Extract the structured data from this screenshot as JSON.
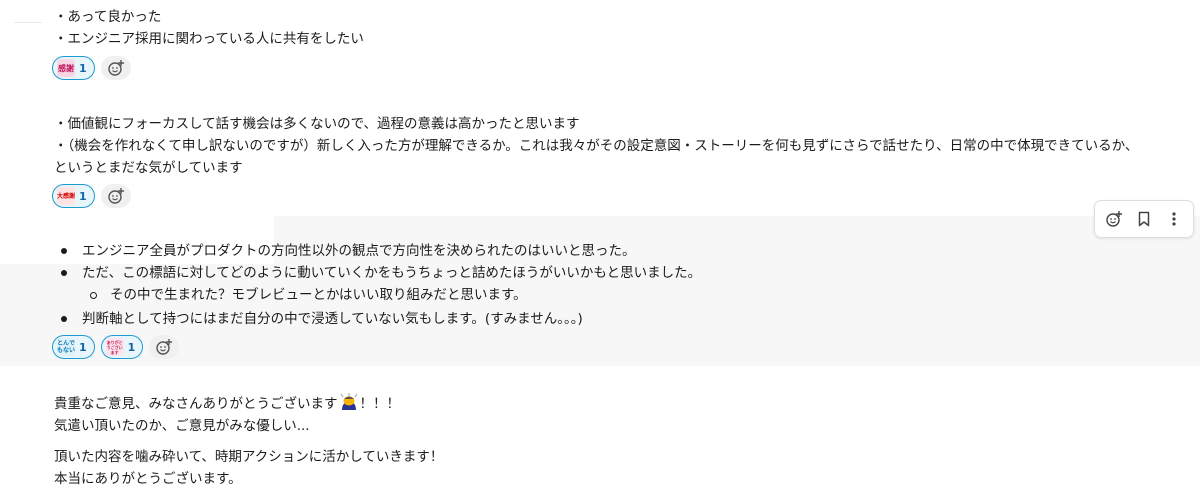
{
  "message1": {
    "lines": [
      "・あって良かった",
      "・エンジニア採用に関わっている人に共有をしたい"
    ],
    "reactions": [
      {
        "emoji": "kansha-emoji",
        "emoji_text": "感謝",
        "count": "1"
      }
    ]
  },
  "message2": {
    "lines": [
      "・価値観にフォーカスして話す機会は多くないので、過程の意義は高かったと思います",
      "・（機会を作れなくて申し訳ないのですが）新しく入った方が理解できるか。これは我々がその設定意図・ストーリーを何も見ずにさらで話せたり、日常の中で体現できているか、",
      "というとまだな気がしています"
    ],
    "reactions": [
      {
        "emoji": "daikansha-emoji",
        "emoji_text": "大感謝",
        "count": "1"
      }
    ]
  },
  "message3": {
    "bullets": [
      "エンジニア全員がプロダクトの方向性以外の観点で方向性を決められたのはいいと思った。",
      "ただ、この標語に対してどのように動いていくかをもうちょっと詰めたほうがいいかもと思いました。"
    ],
    "sub_bullet": "その中で生まれた？モブレビューとかはいい取り組みだと思います。",
    "bullet_last": "判断軸として持つにはまだ自分の中で浸透していない気もします。(すみません。。。)",
    "reactions": [
      {
        "emoji": "tondemonai-emoji",
        "emoji_text": "とんでもない",
        "count": "1"
      },
      {
        "emoji": "arigatou-emoji",
        "emoji_text": "ありがとうございます",
        "count": "1"
      }
    ]
  },
  "message4": {
    "line1_before": "貴重なご意見、みなさんありがとうございます",
    "line1_after": "！！！",
    "line2": "気遣い頂いたのか、ご意見がみな優しい...",
    "line3": "頂いた内容を噛み砕いて、時期アクションに活かしていきます！",
    "line4": "本当にありがとうございます。"
  },
  "toolbar": {
    "icons": [
      "add-reaction-icon",
      "bookmark-icon",
      "more-actions-icon"
    ]
  },
  "colors": {
    "reaction_bg": "#e8f5fa",
    "reaction_border": "#1d9bd1",
    "reaction_count": "#1264a3",
    "hover_bg": "#f7f7f7"
  }
}
